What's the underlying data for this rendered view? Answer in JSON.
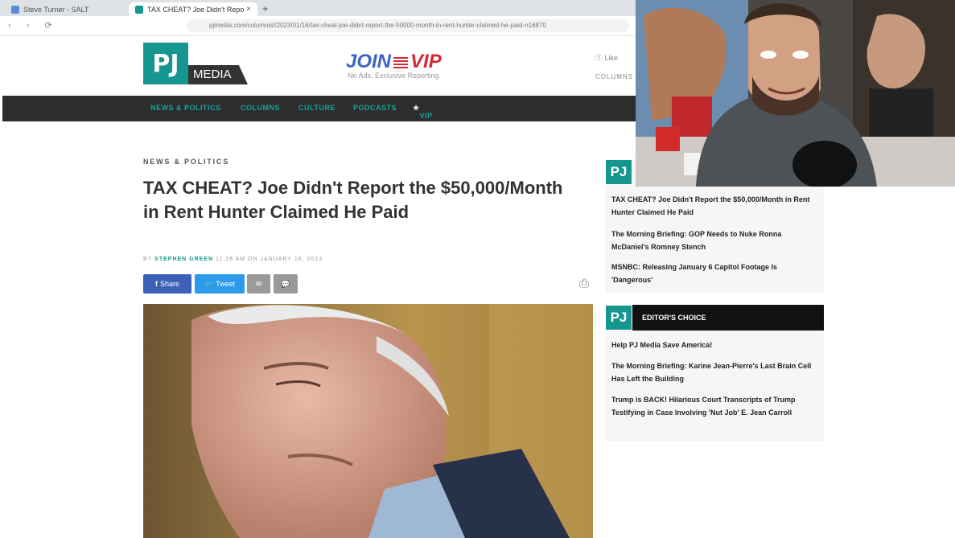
{
  "browser": {
    "tabs": [
      {
        "label": "Steve Turner - SALT",
        "active": false
      },
      {
        "label": "TAX CHEAT? Joe Didn't Report th",
        "active": true
      }
    ],
    "new_tab": "+",
    "url": "pjmedia.com/columnist/2023/01/16/tax-cheat-joe-didnt-report-the-50000-month-in-rent-hunter-claimed-he-paid-n16870"
  },
  "header": {
    "logo_pj": "PJ",
    "logo_media": "MEDIA",
    "join": "JOIN",
    "vip": "VIP",
    "tagline": "No Ads. Exclusive Reporting.",
    "right_top": "Like",
    "right_bottom": "COLUMNS"
  },
  "nav": {
    "items": [
      "NEWS & POLITICS",
      "COLUMNS",
      "CULTURE",
      "PODCASTS",
      "VIP"
    ]
  },
  "article": {
    "kicker": "NEWS & POLITICS",
    "headline": "TAX CHEAT? Joe Didn't Report the $50,000/Month in Rent Hunter Claimed He Paid",
    "byline_prefix": "BY",
    "author": "STEPHEN GREEN",
    "byline_suffix": "11:28 AM ON JANUARY 16, 2023",
    "share_fb": "Share",
    "share_tw": "Tweet"
  },
  "sidebar": {
    "box1_logo": "PJ",
    "box1_links": [
      "TAX CHEAT? Joe Didn't Report the $50,000/Month in Rent Hunter Claimed He Paid",
      "The Morning Briefing: GOP Needs to Nuke Ronna McDaniel's Romney Stench",
      "MSNBC: Releasing January 6 Capitol Footage Is 'Dangerous'"
    ],
    "box2_logo": "PJ",
    "box2_title": "EDITOR'S CHOICE",
    "box2_links": [
      "Help PJ Media Save America!",
      "The Morning Briefing: Karine Jean-Pierre's Last Brain Cell Has Left the Building",
      "Trump is BACK! Hilarious Court Transcripts of Trump Testifying in Case Involving 'Nut Job' E. Jean Carroll"
    ]
  },
  "colors": {
    "brand_teal": "#15968f",
    "nav_dark": "#2d2d2d",
    "facebook": "#3b62b6",
    "twitter": "#2c9bea"
  }
}
